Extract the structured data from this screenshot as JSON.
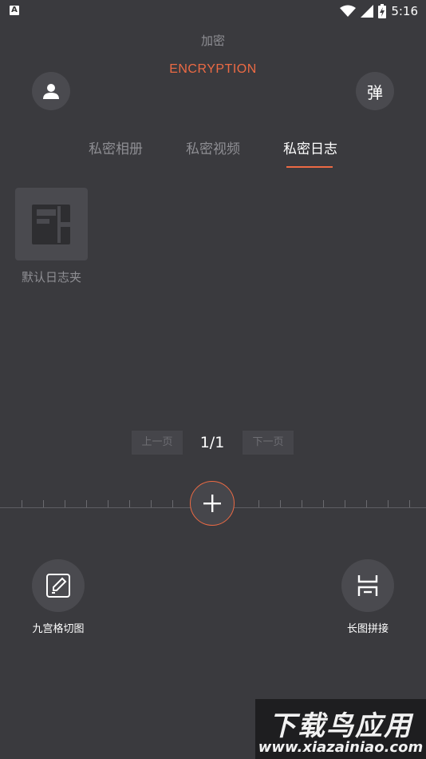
{
  "status_bar": {
    "app_icon": "A",
    "time": "5:16",
    "icons": [
      "wifi-icon",
      "signal-icon",
      "battery-charging-icon"
    ]
  },
  "header": {
    "title_cn": "加密",
    "title_en": "ENCRYPTION",
    "left_icon": "user-icon",
    "right_button_label": "弹"
  },
  "tabs": [
    {
      "label": "私密相册",
      "active": false
    },
    {
      "label": "私密视频",
      "active": false
    },
    {
      "label": "私密日志",
      "active": true
    }
  ],
  "folders": [
    {
      "label": "默认日志夹",
      "icon": "notebook-icon"
    }
  ],
  "pager": {
    "prev_label": "上一页",
    "page_text": "1/1",
    "next_label": "下一页"
  },
  "tools": {
    "grid_cut": {
      "label": "九宫格切图",
      "icon": "edit-pen-icon"
    },
    "long_image": {
      "label": "长图拼接",
      "icon": "long-image-stitch-icon"
    }
  },
  "watermark": {
    "main": "下载鸟应用",
    "url": "www.xiazainiao.com"
  },
  "colors": {
    "background": "#3a3a3e",
    "accent": "#ec6a44",
    "muted_text": "#8e8e93",
    "button_bg": "#4a4a4f"
  }
}
